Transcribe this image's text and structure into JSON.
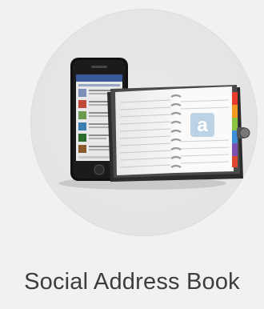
{
  "app": {
    "title": "Social Address Book",
    "icon_name": "address-book-with-phone-icon",
    "book_badge_letter": "a"
  },
  "colors": {
    "tile_background": "#f1f1f1",
    "circle_background": "#e6e6e6",
    "title_text": "#3d3d3d",
    "book_cover": "#3f3f40",
    "tabs": [
      "#e63b2e",
      "#f29a1f",
      "#8ac43f",
      "#3a8fd8",
      "#7d4fb0",
      "#e0462f"
    ]
  }
}
